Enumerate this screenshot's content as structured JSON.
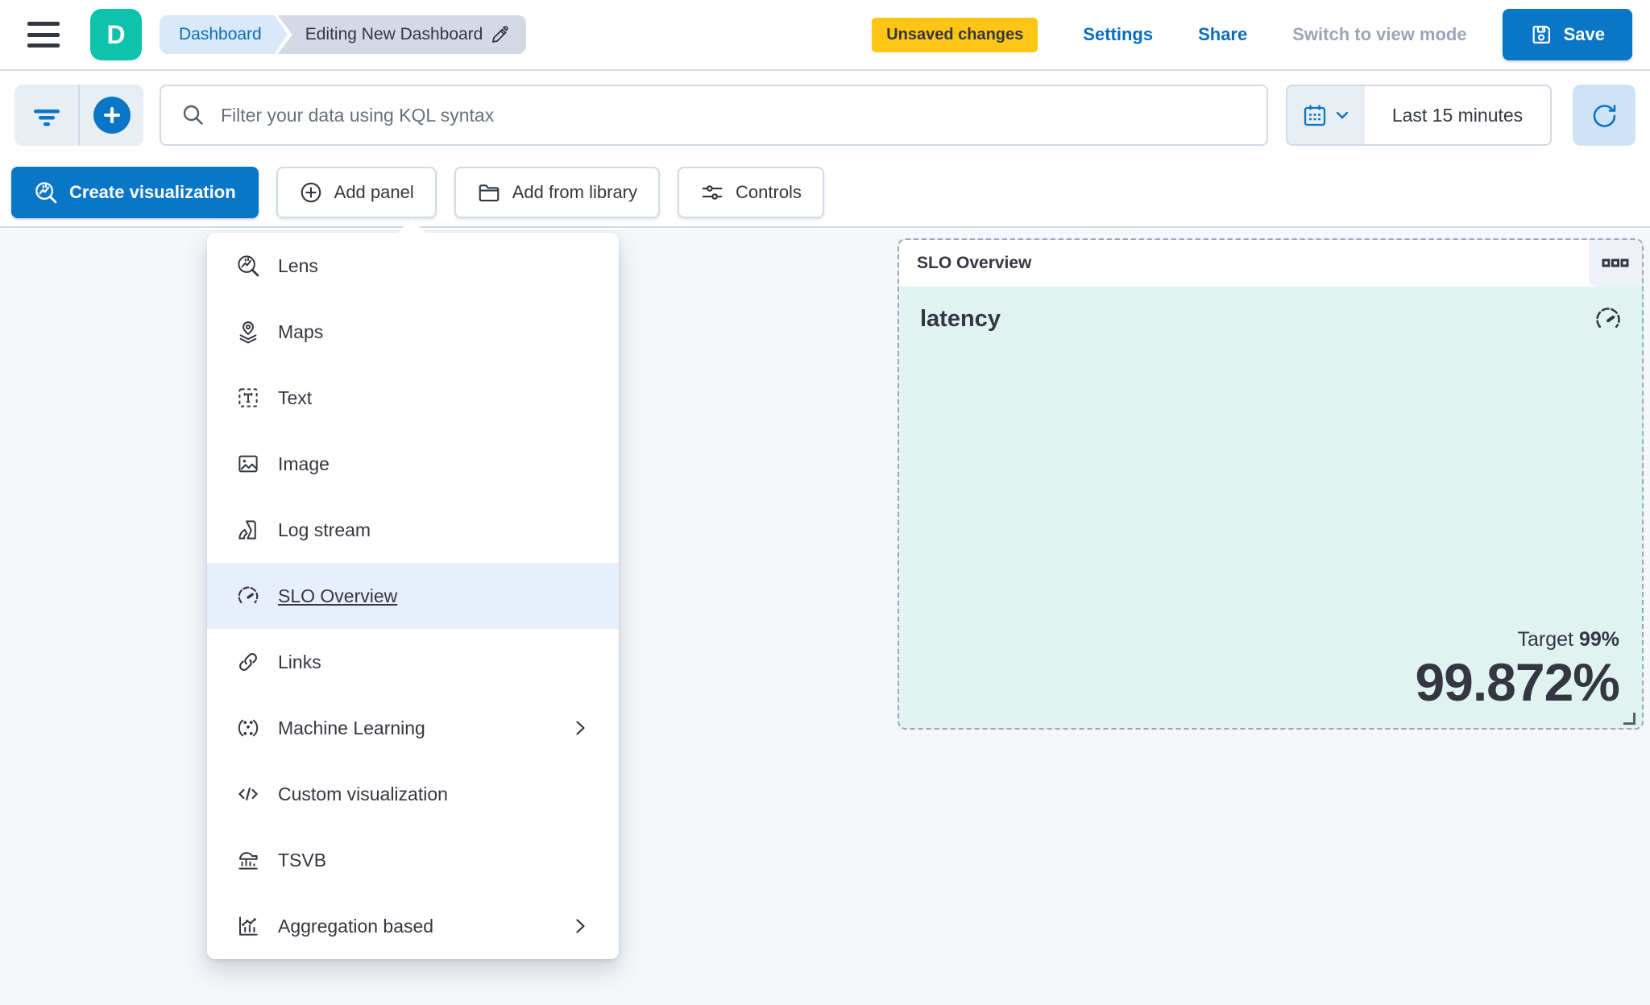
{
  "header": {
    "logo_letter": "D",
    "breadcrumbs": [
      {
        "label": "Dashboard"
      },
      {
        "label": "Editing New Dashboard"
      }
    ],
    "unsaved_badge": "Unsaved changes",
    "settings_label": "Settings",
    "share_label": "Share",
    "switch_view_label": "Switch to view mode",
    "save_label": "Save"
  },
  "query_bar": {
    "placeholder": "Filter your data using KQL syntax",
    "time_range": "Last 15 minutes"
  },
  "toolbar": {
    "create_visualization": "Create visualization",
    "add_panel": "Add panel",
    "add_from_library": "Add from library",
    "controls": "Controls"
  },
  "add_panel_menu": {
    "items": [
      {
        "label": "Lens",
        "icon": "lens-icon"
      },
      {
        "label": "Maps",
        "icon": "maps-icon"
      },
      {
        "label": "Text",
        "icon": "text-icon"
      },
      {
        "label": "Image",
        "icon": "image-icon"
      },
      {
        "label": "Log stream",
        "icon": "log-stream-icon"
      },
      {
        "label": "SLO Overview",
        "icon": "gauge-icon",
        "selected": true
      },
      {
        "label": "Links",
        "icon": "link-icon"
      },
      {
        "label": "Machine Learning",
        "icon": "machine-learning-icon",
        "has_submenu": true
      },
      {
        "label": "Custom visualization",
        "icon": "code-icon"
      },
      {
        "label": "TSVB",
        "icon": "tsvb-icon"
      },
      {
        "label": "Aggregation based",
        "icon": "aggregation-icon",
        "has_submenu": true
      }
    ]
  },
  "slo_panel": {
    "title": "SLO Overview",
    "slo_name": "latency",
    "target_label": "Target",
    "target_value": "99%",
    "observed_value": "99.872%"
  },
  "colors": {
    "primary_blue": "#0a76c7",
    "link_blue": "#0a6cc0",
    "accent_teal": "#0dc3ac",
    "badge_yellow": "#fec514",
    "panel_mint": "#dff3f0",
    "selected_row_blue": "#e7f0fa",
    "text_dark": "#343741",
    "text_gray": "#69707d",
    "disabled_gray": "#9aa5b8",
    "border_gray": "#d3dae6",
    "viewport_bg": "#f5f7fa"
  },
  "icons_used": [
    "menu-icon",
    "edit-pencil-icon",
    "save-floppy-icon",
    "filter-icon",
    "add-filter-plus-icon",
    "search-icon",
    "calendar-icon",
    "chevron-down-icon",
    "refresh-icon",
    "lens-icon",
    "plus-circle-icon",
    "folder-icon",
    "sliders-icon",
    "maps-icon",
    "text-icon",
    "image-icon",
    "log-stream-icon",
    "gauge-icon",
    "link-icon",
    "machine-learning-icon",
    "code-icon",
    "tsvb-icon",
    "aggregation-icon",
    "chevron-right-icon",
    "boxes-horizontal-icon",
    "resize-corner-icon"
  ]
}
